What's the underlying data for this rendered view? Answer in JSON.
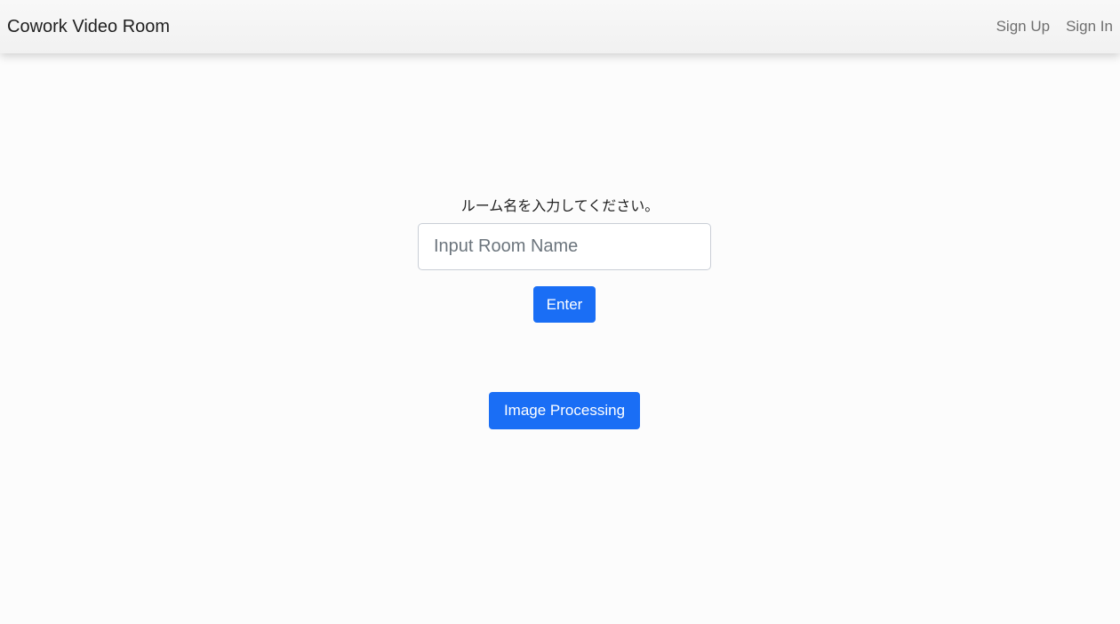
{
  "navbar": {
    "brand": "Cowork Video Room",
    "links": [
      {
        "label": "Sign Up"
      },
      {
        "label": "Sign In"
      }
    ]
  },
  "main": {
    "prompt": "ルーム名を入力してください。",
    "room_input": {
      "value": "",
      "placeholder": "Input Room Name"
    },
    "enter_label": "Enter",
    "image_processing_label": "Image Processing"
  },
  "colors": {
    "primary_button": "#1a6ef5",
    "navbar_bg": "#f4f4f4",
    "page_bg": "#fcfcfc"
  }
}
